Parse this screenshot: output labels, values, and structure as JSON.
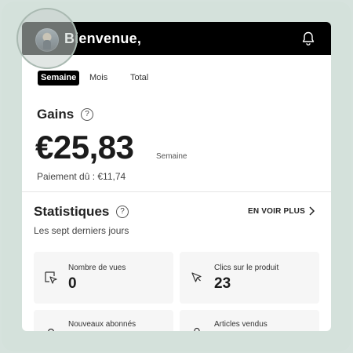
{
  "header": {
    "welcome": "Bienvenue,"
  },
  "tabs": [
    {
      "label": "Semaine",
      "active": true
    },
    {
      "label": "Mois",
      "active": false
    },
    {
      "label": "Total",
      "active": false
    }
  ],
  "earnings": {
    "title": "Gains",
    "help_symbol": "?",
    "amount": "€25,83",
    "period": "Semaine",
    "payment_due": "Paiement dû : €11,74"
  },
  "stats": {
    "title": "Statistiques",
    "help_symbol": "?",
    "subtitle": "Les sept derniers jours",
    "see_more": "EN VOIR PLUS",
    "tiles": [
      {
        "label": "Nombre de vues",
        "value": "0",
        "icon": "cursor-square-icon"
      },
      {
        "label": "Clics sur le produit",
        "value": "23",
        "icon": "cursor-icon"
      },
      {
        "label": "Nouveaux abonnés",
        "value": "",
        "icon": "user-icon"
      },
      {
        "label": "Articles vendus",
        "value": "",
        "icon": "bag-icon"
      }
    ]
  },
  "colors": {
    "background": "#d6e2dd",
    "header": "#000000",
    "tile": "#f6f6f6"
  }
}
